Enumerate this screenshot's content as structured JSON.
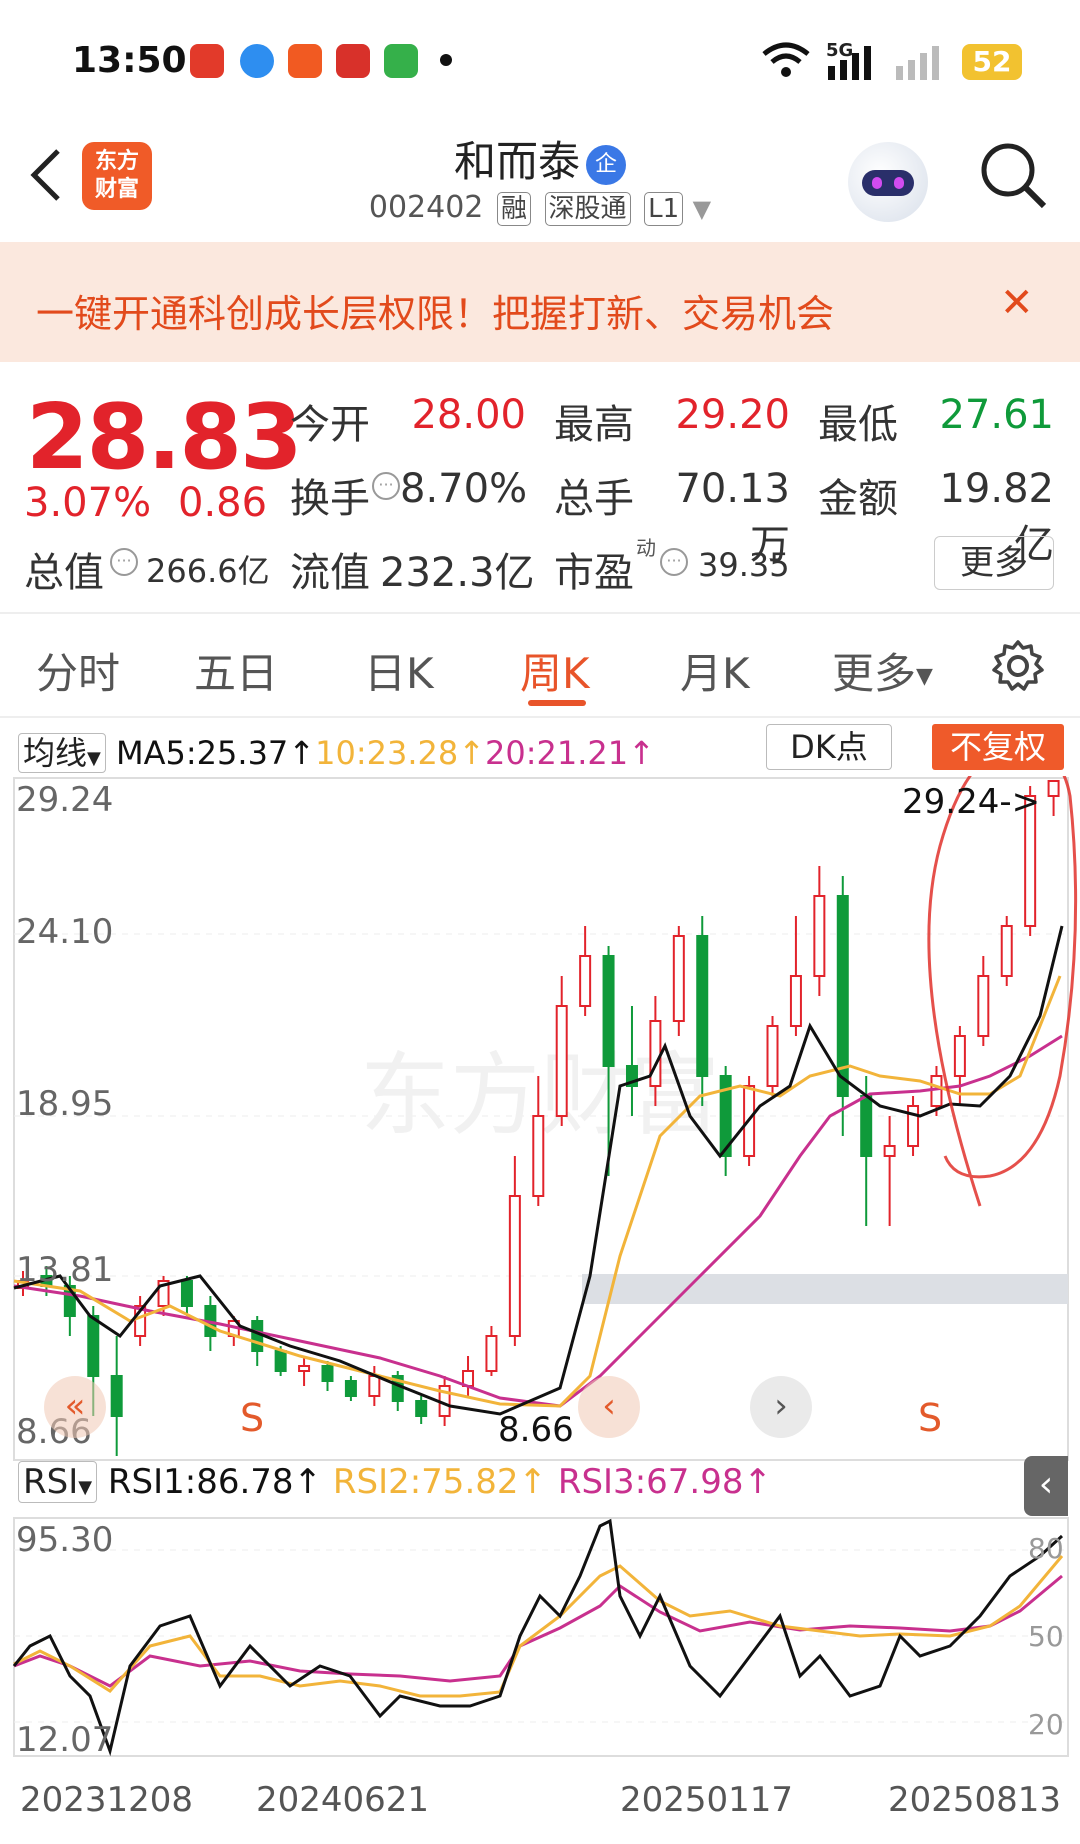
{
  "status_bar": {
    "time": "13:50",
    "network": "5G",
    "battery": "52"
  },
  "header": {
    "logo_text_1": "东方",
    "logo_text_2": "财富",
    "stock_name": "和而泰",
    "badge": "企",
    "stock_code": "002402",
    "tags": [
      "融",
      "深股通",
      "L1"
    ]
  },
  "banner": {
    "text": "一键开通科创成长层权限！把握打新、交易机会",
    "close": "✕"
  },
  "quote": {
    "price": "28.83",
    "change_pct": "3.07%",
    "change": "0.86",
    "open_label": "今开",
    "open": "28.00",
    "high_label": "最高",
    "high": "29.20",
    "low_label": "最低",
    "low": "27.61",
    "turnover_label": "换手",
    "turnover": "8.70%",
    "volume_label": "总手",
    "volume": "70.13万",
    "amount_label": "金额",
    "amount": "19.82亿",
    "mktcap_label": "总值",
    "mktcap": "266.6亿",
    "float_label": "流值",
    "float": "232.3亿",
    "pe_label": "市盈",
    "pe_sup": "动",
    "pe": "39.35",
    "more": "更多"
  },
  "tabs": [
    "分时",
    "五日",
    "日K",
    "周K",
    "月K",
    "更多"
  ],
  "active_tab": "周K",
  "ma": {
    "selector": "均线",
    "ma5": "MA5:25.37↑",
    "ma10": "10:23.28↑",
    "ma20": "20:21.21↑",
    "dk": "DK点",
    "adjust": "不复权"
  },
  "price_axis": {
    "labels": [
      "29.24",
      "24.10",
      "18.95",
      "13.81",
      "8.66"
    ],
    "high_marker": "29.24->",
    "low_marker": "8.66"
  },
  "nav_buttons": {
    "fast_back": "«",
    "back": "‹",
    "forward": "›",
    "s_label": "S"
  },
  "rsi": {
    "selector": "RSI",
    "rsi1": "RSI1:86.78↑",
    "rsi2": "RSI2:75.82↑",
    "rsi3": "RSI3:67.98↑",
    "axis_left": [
      "95.30",
      "12.07"
    ],
    "axis_right": [
      "80",
      "50",
      "20"
    ]
  },
  "dates": [
    "20231208",
    "20240621",
    "20250117",
    "20250813"
  ],
  "watermark": "东方财富",
  "colors": {
    "up": "#e2232b",
    "down": "#0f9a3a",
    "ma5": "#111111",
    "ma10": "#f2b43a",
    "ma20": "#c8308e",
    "accent": "#e8542a"
  }
}
